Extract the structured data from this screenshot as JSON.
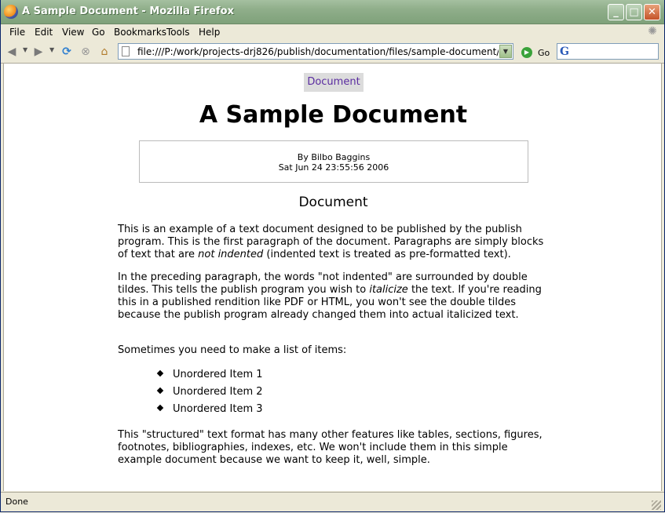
{
  "window": {
    "title": "A Sample Document - Mozilla Firefox",
    "controls": {
      "minimize": "_",
      "maximize": "□",
      "close": "✕"
    }
  },
  "menu": [
    "File",
    "Edit",
    "View",
    "Go",
    "Bookmarks",
    "Tools",
    "Help"
  ],
  "toolbar": {
    "back_icon": "back-arrow-icon",
    "forward_icon": "forward-arrow-icon",
    "reload_icon": "reload-icon",
    "stop_icon": "stop-icon",
    "home_icon": "home-icon",
    "url": "file:///P:/work/projects-drj826/publish/documentation/files/sample-document/sample-document",
    "go_label": "Go",
    "search_value": ""
  },
  "page": {
    "toc_tab": "Document",
    "title": "A Sample Document",
    "author": "By Bilbo Baggins",
    "date": "Sat Jun 24 23:55:56 2006",
    "section_title": "Document",
    "p1_a": "This is an example of a text document designed to be published by the publish program. This is the first paragraph of the document. Paragraphs are simply blocks of text that are ",
    "p1_em": "not indented",
    "p1_b": " (indented text is treated as pre-formatted text).",
    "p2_a": "In the preceding paragraph, the words \"not indented\" are surrounded by double tildes. This tells the publish program you wish to ",
    "p2_em": "italicize",
    "p2_b": " the text. If you're reading this in a published rendition like PDF or HTML, you won't see the double tildes because the publish program already changed them into actual italicized text.",
    "p3": "Sometimes you need to make a list of items:",
    "list_items": [
      "Unordered Item 1",
      "Unordered Item 2",
      "Unordered Item 3"
    ],
    "p4": "This \"structured\" text format has many other features like tables, sections, figures, footnotes, bibliographies, indexes, etc. We won't include them in this simple example document because we want to keep it, well, simple."
  },
  "status": {
    "text": "Done"
  }
}
